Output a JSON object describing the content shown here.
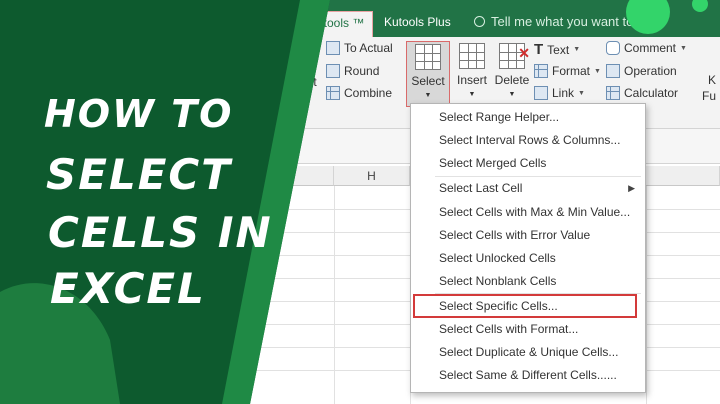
{
  "ribbon": {
    "tabs": [
      "Kutools ™",
      "Kutools Plus"
    ],
    "tell_me": "Tell me what you want to",
    "group_left": {
      "to_actual": "To Actual",
      "round": "Round",
      "combine": "Combine",
      "partial_left": "ent"
    },
    "big_buttons": {
      "select": "Select",
      "insert": "Insert",
      "delete": "Delete"
    },
    "group_text": {
      "text": "Text",
      "format": "Format",
      "link": "Link"
    },
    "group_right": {
      "comment": "Comment",
      "operation": "Operation",
      "calculator": "Calculator"
    },
    "partial_right": [
      "K",
      "Fu"
    ]
  },
  "sheet": {
    "column_h": "H"
  },
  "dropdown": {
    "items": [
      "Select Range Helper...",
      "Select Interval Rows & Columns...",
      "Select Merged Cells",
      "Select Last Cell",
      "Select Cells with Max & Min Value...",
      "Select Cells with Error Value",
      "Select Unlocked Cells",
      "Select Nonblank Cells",
      "Select Specific Cells...",
      "Select Cells with Format...",
      "Select Duplicate & Unique Cells...",
      "Select Same & Different Cells......"
    ],
    "highlighted_item": "Select Specific Cells..."
  },
  "banner": {
    "line1": "HOW TO",
    "line2": "SELECT",
    "line3": "CELLS IN",
    "line4": "EXCEL"
  },
  "colors": {
    "excel_green": "#217346",
    "banner_dark_green": "#0d5a2e",
    "banner_mid_green": "#1f8a45",
    "accent_lime": "#33d46a",
    "highlight_red": "#d33a3a"
  }
}
